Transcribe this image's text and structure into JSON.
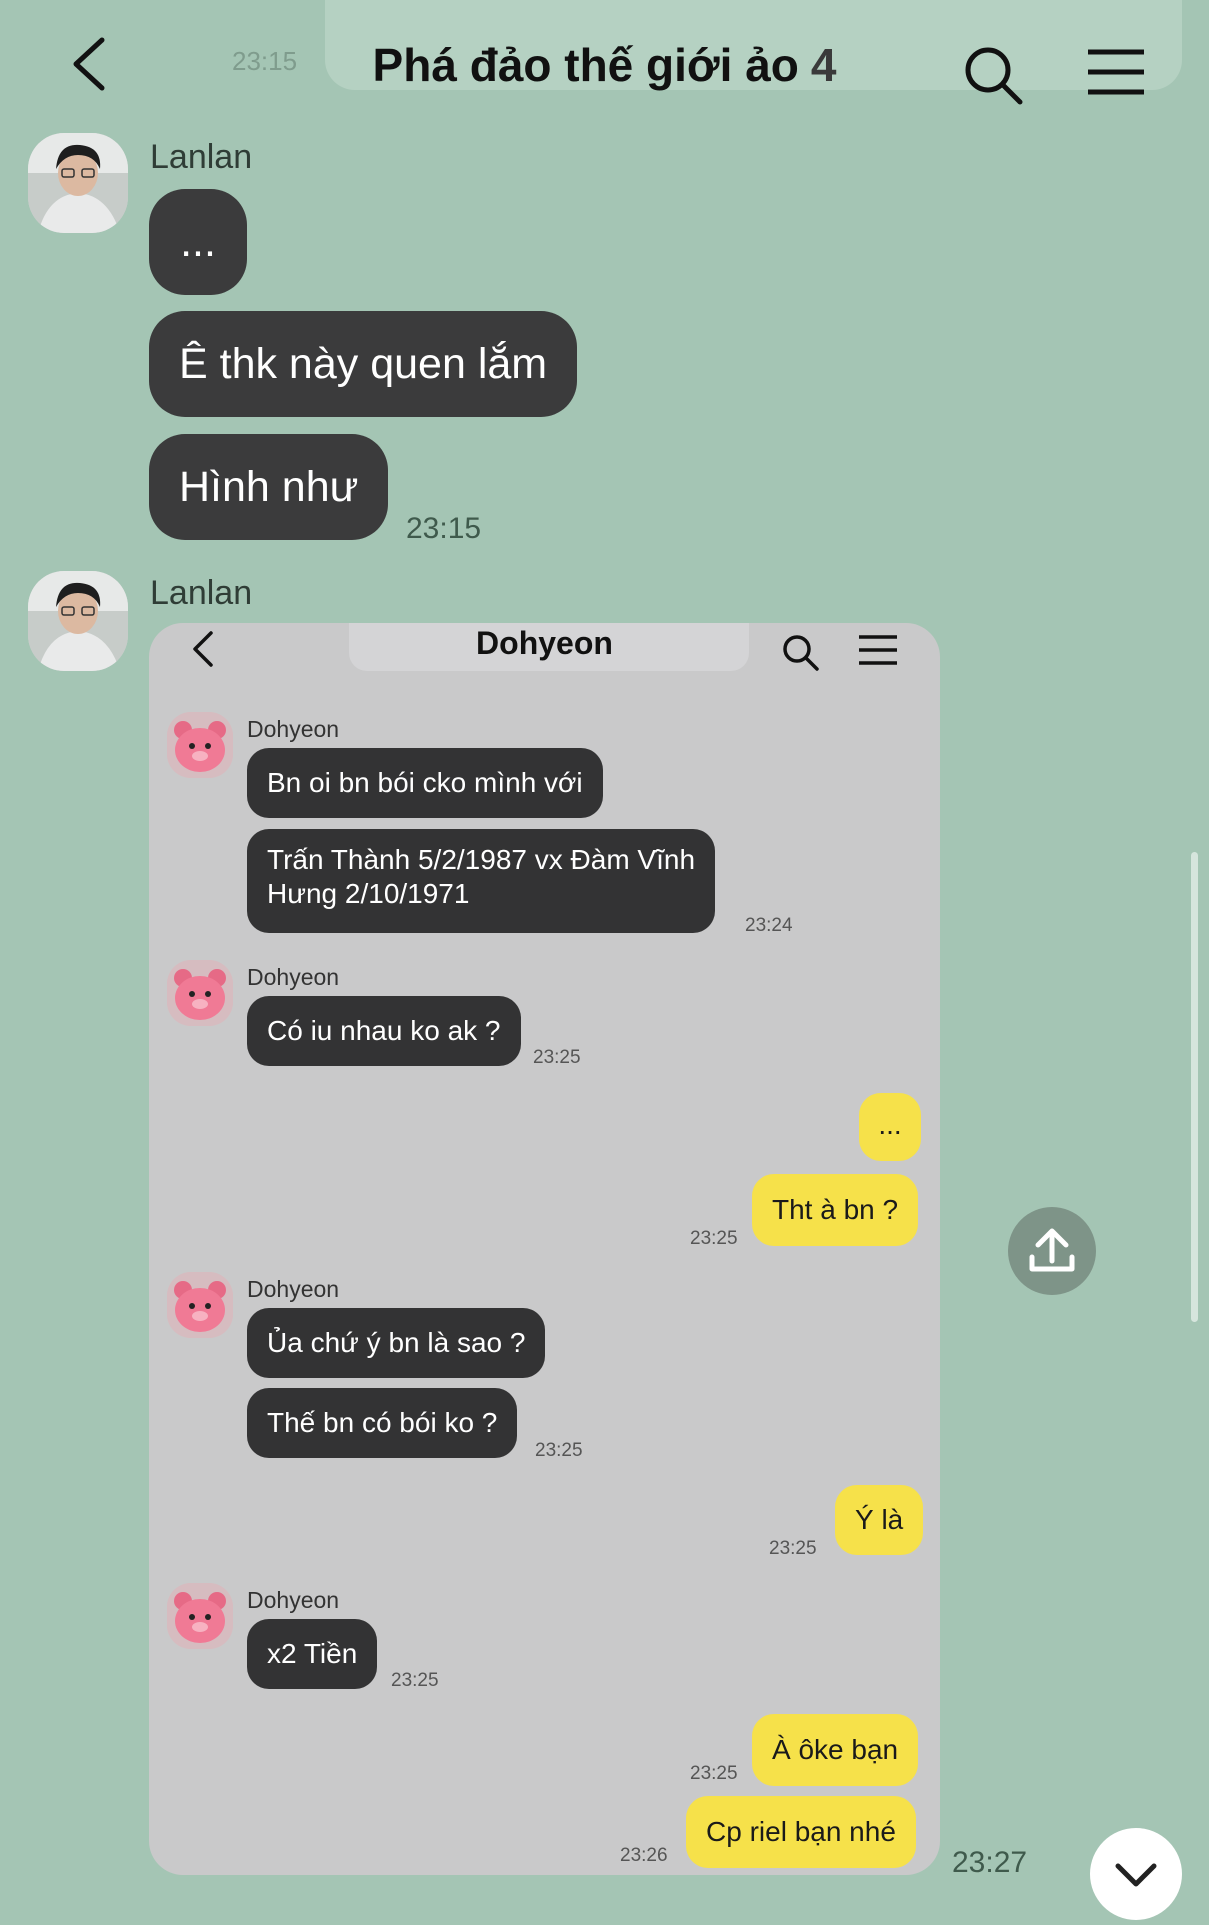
{
  "header": {
    "ghost_time": "23:15",
    "title": "Phá đảo thế giới ảo",
    "member_count": "4"
  },
  "messages": {
    "group1": {
      "sender": "Lanlan",
      "bubbles": [
        "...",
        "Ê thk này quen lắm",
        "Hình như"
      ],
      "time": "23:15"
    },
    "group2": {
      "sender": "Lanlan",
      "time": "23:27"
    }
  },
  "screenshot": {
    "title": "Dohyeon",
    "incoming": [
      {
        "name": "Dohyeon",
        "bubbles": [
          "Bn oi bn bói cko mình với",
          "Trấn Thành 5/2/1987 vx Đàm Vĩnh\nHưng 2/10/1971"
        ],
        "time": "23:24"
      },
      {
        "name": "Dohyeon",
        "bubbles": [
          "Có iu nhau ko ak ?"
        ],
        "time": "23:25"
      },
      {
        "name": "Dohyeon",
        "bubbles": [
          "Ủa chứ ý bn là sao ?",
          "Thế bn có bói ko ?"
        ],
        "time": "23:25"
      },
      {
        "name": "Dohyeon",
        "bubbles": [
          "x2 Tiền"
        ],
        "time": "23:25"
      }
    ],
    "outgoing": [
      {
        "bubbles": [
          "...",
          "Tht à bn ?"
        ],
        "time": "23:25"
      },
      {
        "bubbles": [
          "Ý là"
        ],
        "time": "23:25"
      },
      {
        "bubbles": [
          "À ôke bạn"
        ],
        "time": "23:25"
      },
      {
        "bubbles": [
          "Cp riel bạn nhé"
        ],
        "time": "23:26"
      }
    ]
  },
  "icons": {
    "back": "chevron-left-icon",
    "search": "search-icon",
    "menu": "hamburger-menu-icon",
    "share": "share-upload-icon",
    "scroll_down": "chevron-down-icon"
  },
  "colors": {
    "background": "#a4c5b4",
    "bubble_dark": "#3b3b3c",
    "bubble_yellow": "#f6e14a",
    "screenshot_bg": "#c9c9ca"
  }
}
